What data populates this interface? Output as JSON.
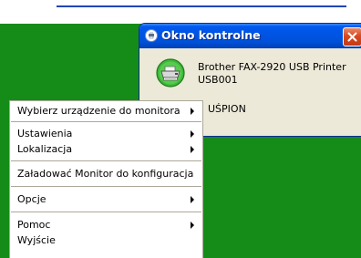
{
  "window": {
    "title": "Okno kontrolne",
    "device_name": "Brother FAX-2920 USB Printer",
    "device_port": "USB001",
    "status": "UŚPION"
  },
  "menu": {
    "items": [
      {
        "label": "Wybierz urządzenie do monitora",
        "submenu": true
      },
      {
        "label": "Ustawienia",
        "submenu": true
      },
      {
        "label": "Lokalizacja",
        "submenu": true
      },
      {
        "label": "Załadować Monitor do konfiguracja",
        "submenu": false
      },
      {
        "label": "Opcje",
        "submenu": true
      },
      {
        "label": "Pomoc",
        "submenu": true
      },
      {
        "label": "Wyjście",
        "submenu": false
      }
    ]
  },
  "icons": {
    "title_icon": "printer-status-icon",
    "close": "close-icon",
    "printer": "printer-icon",
    "submenu_arrow": "submenu-arrow-icon"
  },
  "colors": {
    "desktop_background": "#158c17",
    "titlebar": "#0054e3",
    "close_button": "#d9481f",
    "window_body": "#ece9d8",
    "status_ok": "#3fb83a"
  }
}
